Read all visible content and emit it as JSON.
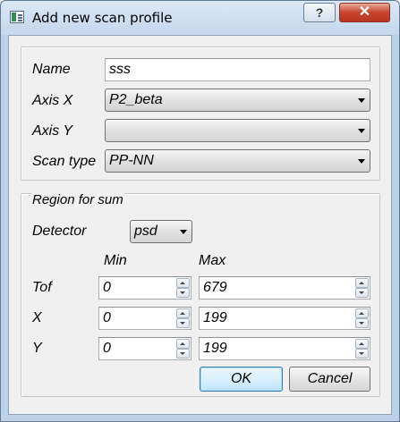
{
  "window": {
    "title": "Add new scan profile",
    "help_button": "?",
    "close_button": "✕"
  },
  "profile": {
    "name_label": "Name",
    "name_value": "sss",
    "axis_x_label": "Axis X",
    "axis_x_value": "P2_beta",
    "axis_y_label": "Axis Y",
    "axis_y_value": "",
    "scan_type_label": "Scan type",
    "scan_type_value": "PP-NN"
  },
  "region": {
    "title": "Region for sum",
    "detector_label": "Detector",
    "detector_value": "psd",
    "min_header": "Min",
    "max_header": "Max",
    "rows": [
      {
        "label": "Tof",
        "min": "0",
        "max": "679"
      },
      {
        "label": "X",
        "min": "0",
        "max": "199"
      },
      {
        "label": "Y",
        "min": "0",
        "max": "199"
      }
    ]
  },
  "buttons": {
    "ok": "OK",
    "cancel": "Cancel"
  }
}
